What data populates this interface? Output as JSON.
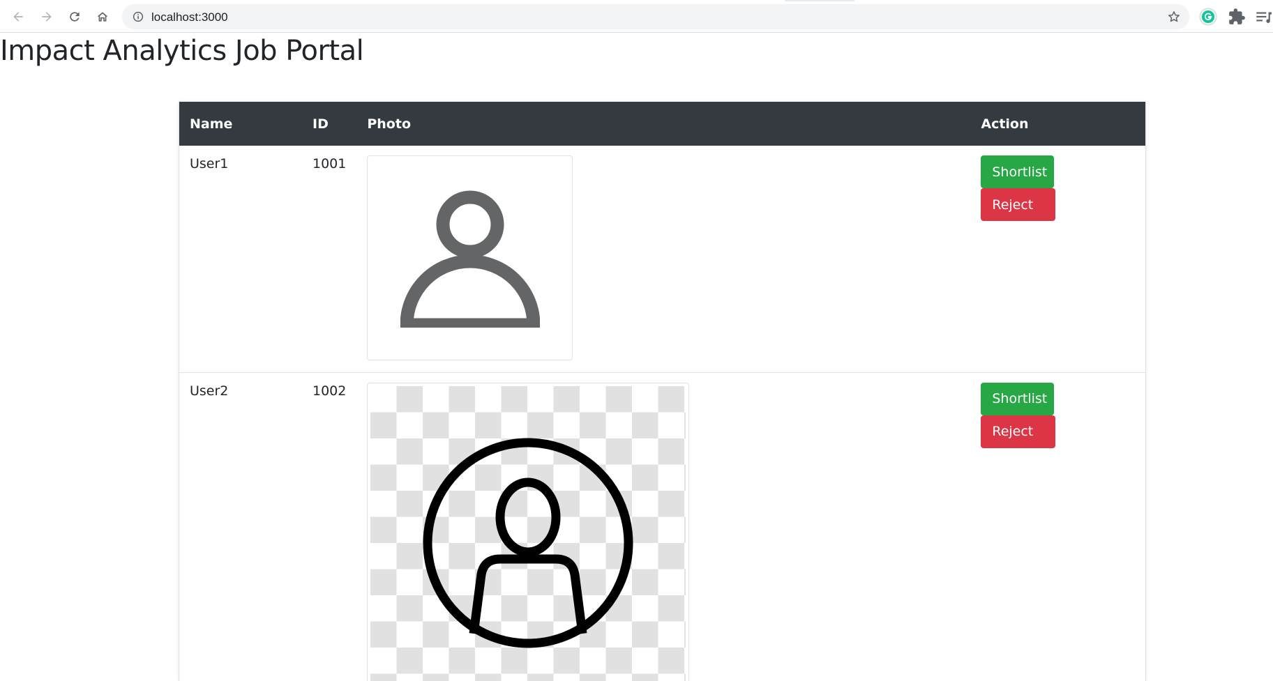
{
  "browser": {
    "url": "localhost:3000",
    "icons": {
      "back": "back-arrow-icon",
      "forward": "forward-arrow-icon",
      "reload": "reload-icon",
      "home": "home-icon",
      "site_info": "info-icon",
      "bookmark": "star-icon",
      "grammarly": "grammarly-icon",
      "extensions": "puzzle-icon",
      "reading_list": "reading-list-icon"
    }
  },
  "page": {
    "title": "Impact Analytics Job Portal"
  },
  "table": {
    "headers": {
      "name": "Name",
      "id": "ID",
      "photo": "Photo",
      "action": "Action"
    },
    "rows": [
      {
        "name": "User1",
        "id": "1001",
        "photo_icon": "user-silhouette-icon",
        "shortlist_label": "Shortlist",
        "reject_label": "Reject"
      },
      {
        "name": "User2",
        "id": "1002",
        "photo_icon": "user-circle-icon",
        "shortlist_label": "Shortlist",
        "reject_label": "Reject"
      }
    ]
  },
  "colors": {
    "header_bg": "#343a40",
    "shortlist": "#28a745",
    "reject": "#dc3545",
    "grammarly": "#15c39a"
  }
}
